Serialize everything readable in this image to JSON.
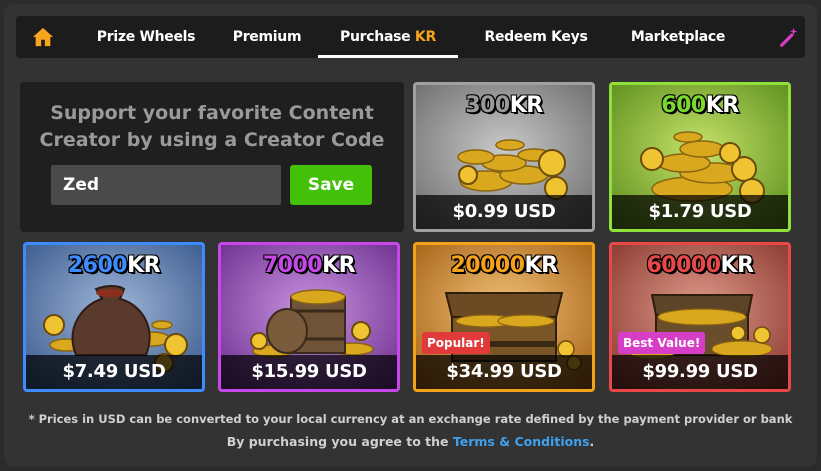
{
  "nav": {
    "home_icon": "home-icon",
    "tabs": [
      {
        "label": "Prize Wheels"
      },
      {
        "label": "Premium"
      },
      {
        "label_prefix": "Purchase ",
        "label_accent": "KR",
        "active": true
      },
      {
        "label": "Redeem Keys"
      },
      {
        "label": "Marketplace"
      }
    ],
    "wand_icon": "magic-wand-icon"
  },
  "creator": {
    "title_line1": "Support your favorite Content",
    "title_line2": "Creator by using a Creator Code",
    "input_value": "Zed",
    "save_label": "Save"
  },
  "products": [
    {
      "amount": "300",
      "currency": "KR",
      "price": "$0.99 USD",
      "accent": "#9a9a9a",
      "border": "#a0a0a0",
      "badge": ""
    },
    {
      "amount": "600",
      "currency": "KR",
      "price": "$1.79 USD",
      "accent": "#7bd82e",
      "border": "#8fe03a",
      "badge": ""
    },
    {
      "amount": "2600",
      "currency": "KR",
      "price": "$7.49 USD",
      "accent": "#3d8bff",
      "border": "#3d8bff",
      "badge": ""
    },
    {
      "amount": "7000",
      "currency": "KR",
      "price": "$15.99 USD",
      "accent": "#c648e8",
      "border": "#c648e8",
      "badge": ""
    },
    {
      "amount": "20000",
      "currency": "KR",
      "price": "$34.99 USD",
      "accent": "#f5a21a",
      "border": "#f5a21a",
      "badge": "Popular!",
      "badge_color": "#e03a3a"
    },
    {
      "amount": "60000",
      "currency": "KR",
      "price": "$99.99 USD",
      "accent": "#e84848",
      "border": "#e84848",
      "badge": "Best Value!",
      "badge_color": "#d63ec6"
    }
  ],
  "footer": {
    "note": "* Prices in USD can be converted to your local currency at an exchange rate defined by the payment provider or bank",
    "agree_prefix": "By purchasing you agree to the ",
    "terms_label": "Terms & Conditions",
    "agree_suffix": "."
  }
}
